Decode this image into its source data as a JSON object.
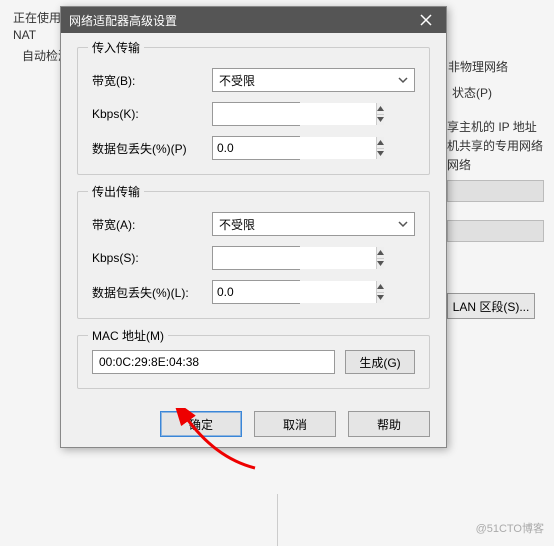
{
  "background": {
    "line1": "正在使用",
    "line2": "NAT",
    "line3": "自动检测",
    "right1": "非物理网络",
    "right2": "状态(P)",
    "right3": "享主机的 IP 地址",
    "right4": "机共享的专用网络",
    "right5": "网络",
    "lan_button": "LAN 区段(S)..."
  },
  "dialog": {
    "title": "网络适配器高级设置",
    "incoming": {
      "legend": "传入传输",
      "bandwidth_label": "带宽(B):",
      "bandwidth_value": "不受限",
      "kbps_label": "Kbps(K):",
      "kbps_value": "",
      "packet_loss_label": "数据包丢失(%)(P)",
      "packet_loss_value": "0.0"
    },
    "outgoing": {
      "legend": "传出传输",
      "bandwidth_label": "带宽(A):",
      "bandwidth_value": "不受限",
      "kbps_label": "Kbps(S):",
      "kbps_value": "",
      "packet_loss_label": "数据包丢失(%)(L):",
      "packet_loss_value": "0.0"
    },
    "mac": {
      "legend": "MAC 地址(M)",
      "value": "00:0C:29:8E:04:38",
      "generate_label": "生成(G)"
    },
    "buttons": {
      "ok": "确定",
      "cancel": "取消",
      "help": "帮助"
    }
  },
  "watermark": "@51CTO博客"
}
